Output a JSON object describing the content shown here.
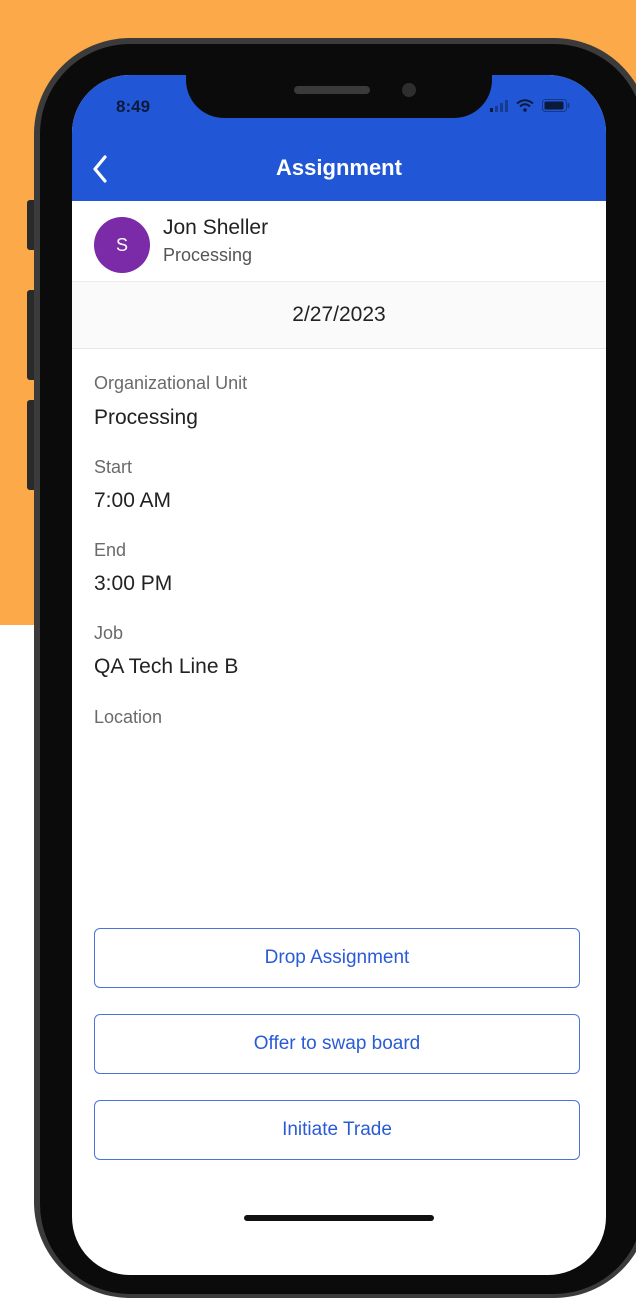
{
  "status_bar": {
    "time": "8:49"
  },
  "header": {
    "title": "Assignment"
  },
  "employee": {
    "initial": "S",
    "name": "Jon Sheller",
    "department": "Processing"
  },
  "date": "2/27/2023",
  "details": [
    {
      "label": "Organizational Unit",
      "value": "Processing"
    },
    {
      "label": "Start",
      "value": "7:00 AM"
    },
    {
      "label": "End",
      "value": "3:00 PM"
    },
    {
      "label": "Job",
      "value": "QA Tech Line B"
    },
    {
      "label": "Location",
      "value": ""
    }
  ],
  "actions": {
    "drop": "Drop Assignment",
    "offer": "Offer to swap board",
    "trade": "Initiate Trade"
  },
  "colors": {
    "appbar": "#2157d6",
    "avatar": "#7b2aa8",
    "button_text": "#2a5bd7",
    "background": "#fba949"
  }
}
